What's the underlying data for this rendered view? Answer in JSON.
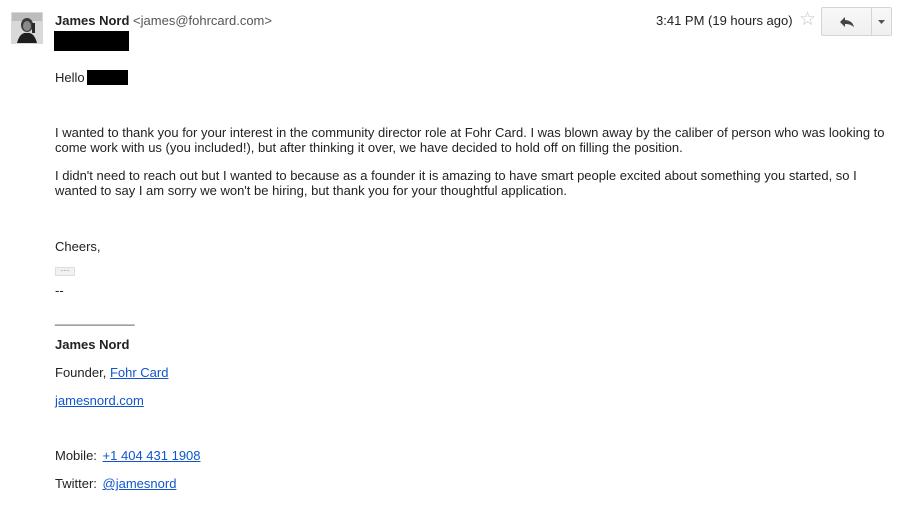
{
  "header": {
    "sender_name": "James Nord",
    "sender_email": "<james@fohrcard.com>",
    "timestamp": "3:41 PM (19 hours ago)",
    "star_icon": "star-outline",
    "reply_icon": "reply-arrow",
    "more_icon": "dropdown-caret"
  },
  "body": {
    "greeting": "Hello",
    "paragraph1": "I wanted to thank you for your interest in the community director role at Fohr Card. I was blown away by the caliber of person who was looking to come work with us (you included!), but after thinking it over, we have decided to hold off on filling the position.",
    "paragraph2": "I didn't need to reach out but I wanted to because as a founder it is amazing to have smart people excited about something you started, so I wanted to say I am sorry we won't be hiring, but thank you for your thoughtful application.",
    "closing": "Cheers,",
    "trimmed_content_label": "···"
  },
  "signature": {
    "dash": "--",
    "rule": "___________",
    "name": "James Nord",
    "title_prefix": "Founder, ",
    "company_link": "Fohr Card",
    "website_link": "jamesnord.com",
    "mobile_label": "Mobile:",
    "mobile_link": "+1 404 431 1908",
    "twitter_label": "Twitter:",
    "twitter_link": "@jamesnord"
  },
  "colors": {
    "link": "#1155cc",
    "text": "#222222",
    "redaction": "#000000"
  }
}
